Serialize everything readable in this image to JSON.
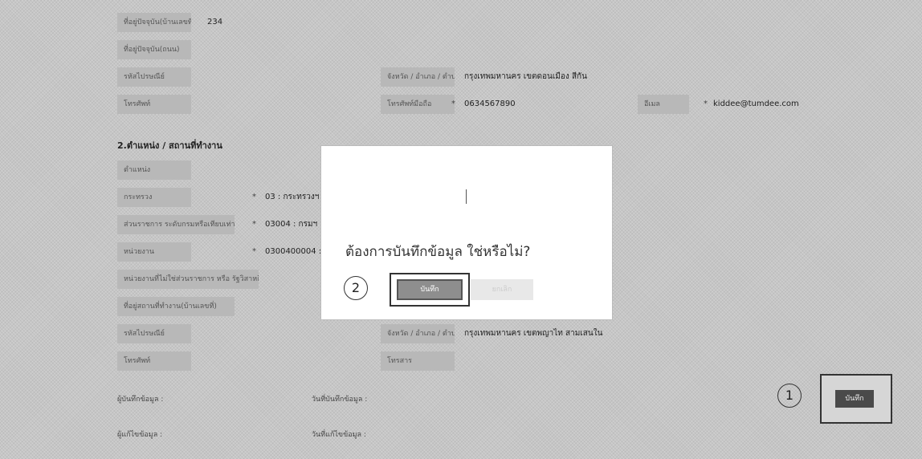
{
  "personal": {
    "house_no_label": "ที่อยู่ปัจจุบัน(บ้านเลขที่)",
    "house_no_value": "234",
    "address_label": "ที่อยู่ปัจจุบัน(ถนน)",
    "postal_label": "รหัสไปรษณีย์",
    "province_label": "จังหวัด / อำเภอ / ตำบล",
    "province_value": "กรุงเทพมหานคร เขตดอนเมือง สีกัน",
    "phone_label": "โทรศัพท์",
    "mobile_label": "โทรศัพท์มือถือ",
    "mobile_value": "0634567890",
    "email_label": "อีเมล",
    "email_value": "kiddee@tumdee.com"
  },
  "work": {
    "section_title": "2.ตำแหน่ง / สถานที่ทำงาน",
    "position_label": "ตำแหน่ง",
    "ministry_label": "กระทรวง",
    "ministry_value": "03 : กระทรวงฯ",
    "dept_label": "ส่วนราชการ ระดับกรมหรือเทียบเท่า",
    "dept_value": "03004 : กรมฯ",
    "division_label": "หน่วยงาน",
    "division_value": "0300400004 :",
    "state_org_label": "หน่วยงานที่ไม่ใช่ส่วนราชการ หรือ รัฐวิสาหกิจ",
    "office_address_label": "ที่อยู่สถานที่ทำงาน(บ้านเลขที่)",
    "office_postal_label": "รหัสไปรษณีย์",
    "office_province_label": "จังหวัด / อำเภอ / ตำบล",
    "office_province_value": "กรุงเทพมหานคร เขตพญาไท สามเสนใน",
    "office_phone_label": "โทรศัพท์",
    "office_fax_label": "โทรสาร"
  },
  "footer": {
    "recorder_label": "ผู้บันทึกข้อมูล :",
    "record_date_label": "วันที่บันทึกข้อมูล :",
    "editor_label": "ผู้แก้ไขข้อมูล :",
    "edit_date_label": "วันที่แก้ไขข้อมูล :",
    "save_button": "บันทึก"
  },
  "dialog": {
    "question": "ต้องการบันทึกข้อมูล ใช่หรือไม่?",
    "save_button": "บันทึก",
    "cancel_button": "ยกเลิก"
  },
  "callouts": {
    "one": "1",
    "two": "2"
  }
}
